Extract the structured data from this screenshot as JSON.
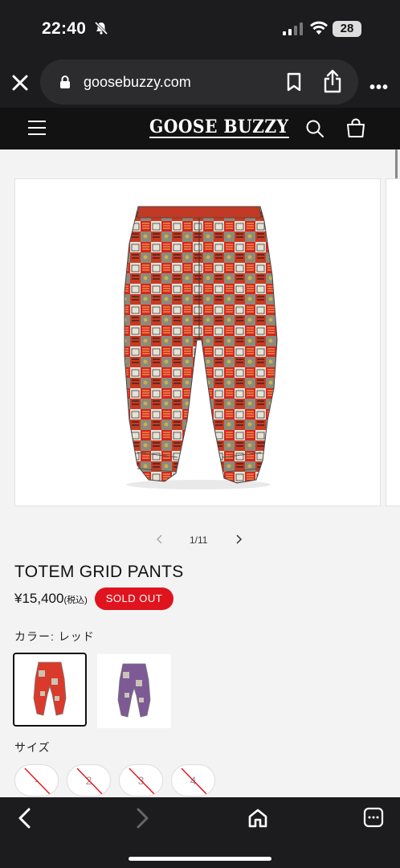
{
  "status": {
    "time": "22:40",
    "battery": "28"
  },
  "browser": {
    "url": "goosebuzzy.com"
  },
  "header": {
    "logo": "GOOSE BUZZY"
  },
  "gallery": {
    "current": 1,
    "total": 11,
    "counter": "1/11"
  },
  "product": {
    "title": "TOTEM GRID PANTS",
    "price": "¥15,400",
    "tax_note": "(税込)",
    "status_badge": "SOLD OUT"
  },
  "color": {
    "label": "カラー: レッド",
    "options": [
      {
        "name": "red",
        "selected": true,
        "hex": "#d93a2b"
      },
      {
        "name": "purple",
        "selected": false,
        "hex": "#7d5a96"
      }
    ]
  },
  "size": {
    "label": "サイズ",
    "options": [
      "-",
      "2",
      "3",
      "4"
    ],
    "all_unavailable": true
  },
  "colors": {
    "sold_out": "#e0141e",
    "header_bg": "#121212",
    "chrome_bg": "#1c1c1e"
  }
}
